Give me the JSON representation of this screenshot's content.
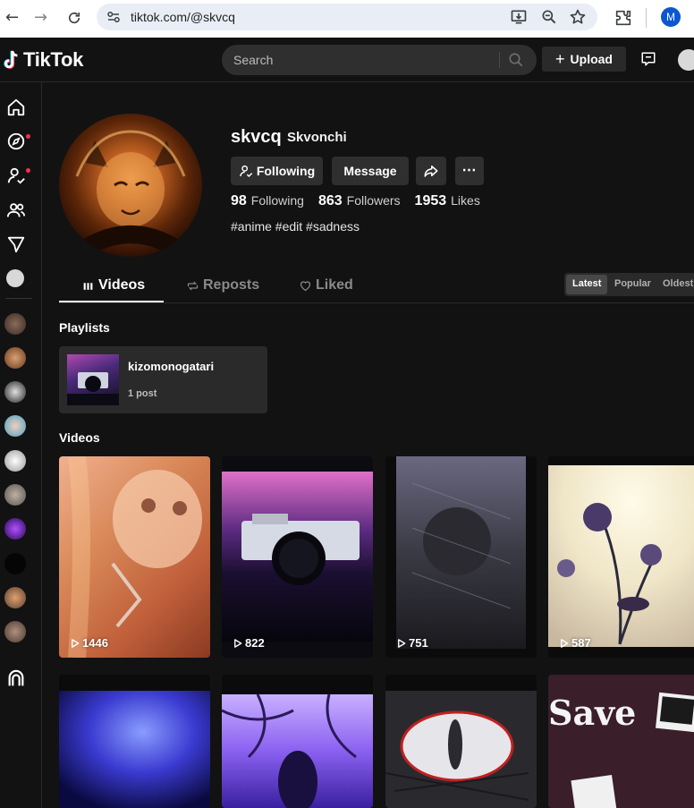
{
  "browser": {
    "url": "tiktok.com/@skvcq",
    "profile_initial": "M"
  },
  "header": {
    "logo_text": "TikTok",
    "search_placeholder": "Search",
    "upload_label": "Upload"
  },
  "profile": {
    "username": "skvcq",
    "nickname": "Skvonchi",
    "following_button": "Following",
    "message_button": "Message",
    "stats": {
      "following_count": "98",
      "following_label": "Following",
      "followers_count": "863",
      "followers_label": "Followers",
      "likes_count": "1953",
      "likes_label": "Likes"
    },
    "bio": "#anime #edit #sadness"
  },
  "tabs": [
    {
      "label": "Videos"
    },
    {
      "label": "Reposts"
    },
    {
      "label": "Liked"
    }
  ],
  "sort_options": [
    "Latest",
    "Popular",
    "Oldest"
  ],
  "sections": {
    "playlists_title": "Playlists",
    "videos_title": "Videos"
  },
  "playlist": {
    "name": "kizomonogatari",
    "count": "1 post"
  },
  "videos": [
    {
      "views": "1446"
    },
    {
      "views": "822"
    },
    {
      "views": "751"
    },
    {
      "views": "587"
    },
    {
      "views": ""
    },
    {
      "views": ""
    },
    {
      "views": ""
    },
    {
      "views": ""
    }
  ],
  "video_overlay_text": "Save",
  "colors": {
    "accent": "#fe2c55",
    "background": "#121212",
    "button": "#2f2f2f"
  }
}
